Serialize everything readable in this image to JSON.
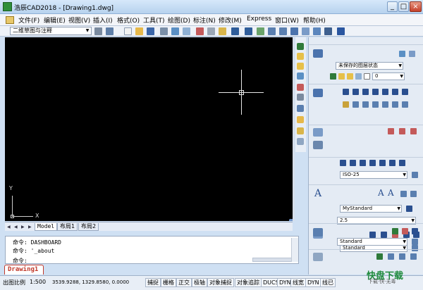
{
  "window": {
    "title": "浩辰CAD2018 - [Drawing1.dwg]",
    "controls": [
      "_",
      "□",
      "×"
    ]
  },
  "menu": [
    "文件(F)",
    "编辑(E)",
    "视图(V)",
    "插入(I)",
    "格式(O)",
    "工具(T)",
    "绘图(D)",
    "标注(N)",
    "修改(M)",
    "Express",
    "窗口(W)",
    "帮助(H)"
  ],
  "toolbar": {
    "workspace": "二维草图与注释"
  },
  "canvas": {
    "axis_x": "X",
    "axis_y": "Y",
    "background": "#000000"
  },
  "layout_tabs": [
    "Model",
    "布局1",
    "布局2"
  ],
  "command": {
    "lines": [
      "命令: DASHBOARD",
      "命令: '_about"
    ],
    "prompt": "命令:"
  },
  "document_tab": "Drawing1",
  "status": {
    "scale_label": "出图比例",
    "scale_value": "1:500",
    "coords": "3539.9288, 1329.8580, 0.0000",
    "buttons": [
      "捕捉",
      "栅格",
      "正交",
      "极轴",
      "对象捕捉",
      "对象追踪",
      "DUCS",
      "DYN",
      "线宽",
      "DYN",
      "线已"
    ]
  },
  "panel": {
    "layer_state": "未保存的图层状态",
    "layer_name": "0",
    "dim_style": "ISO-25",
    "text_style": "MyStandard",
    "text_height": "2.5",
    "table_style": "Standard",
    "mleader_style": "Standard"
  },
  "watermark": {
    "main": "快盘下载",
    "sub": "下载·快·无毒"
  },
  "colors": {
    "accent": "#2a4f8f",
    "doc_tab": "#c0392b"
  }
}
